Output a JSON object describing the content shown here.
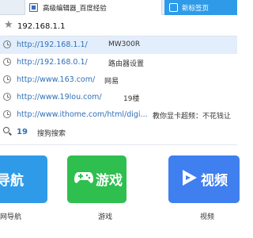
{
  "tabs": [
    {
      "title": "高级编辑器_百度经验"
    },
    {
      "title": "新标签页"
    }
  ],
  "address_bar": {
    "value": "192.168.1.1"
  },
  "suggestions": [
    {
      "url": "http://192.168.1.1/",
      "title": "MW300R"
    },
    {
      "url": "http://192.168.0.1/",
      "title": "路由器设置"
    },
    {
      "url": "http://www.163.com/",
      "title": "网易"
    },
    {
      "url": "http://www.19lou.com/",
      "title": "19楼"
    },
    {
      "url": "http://www.ithome.com/html/digi...",
      "title": "教你显卡超频：不花钱让"
    }
  ],
  "search_suggestion": {
    "query": "19",
    "label": "搜狗搜索"
  },
  "tiles": [
    {
      "label": "导航",
      "caption": "网导航",
      "color": "#2f9be8",
      "icon": "compass-icon"
    },
    {
      "label": "游戏",
      "caption": "游戏",
      "color": "#2fbf4f",
      "icon": "gamepad-icon"
    },
    {
      "label": "视频",
      "caption": "视频",
      "color": "#3f7ff0",
      "icon": "play-icon"
    }
  ]
}
